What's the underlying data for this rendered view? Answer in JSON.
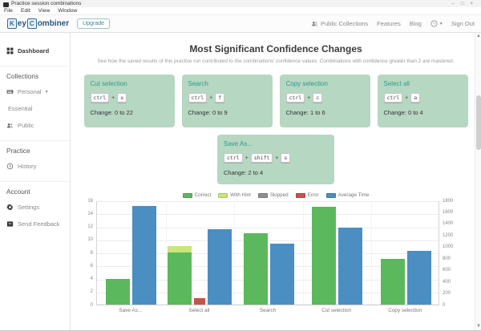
{
  "window": {
    "title": "Practice session combinations",
    "menu": [
      "File",
      "Edit",
      "View",
      "Window"
    ],
    "controls": {
      "minimize": "–",
      "maximize": "□",
      "close": "×"
    }
  },
  "header": {
    "logo": {
      "key_k": "K",
      "mid": "ey",
      "key_c": "C",
      "rest": "ombiner"
    },
    "upgrade_label": "Upgrade",
    "nav": {
      "public_collections": "Public Collections",
      "features": "Features",
      "blog": "Blog",
      "help": "?",
      "sign_out": "Sign Out"
    }
  },
  "sidebar": {
    "dashboard": "Dashboard",
    "sections": [
      {
        "header": "Collections",
        "items": [
          {
            "label": "Personal"
          },
          {
            "label": "Essential"
          },
          {
            "label": "Public"
          }
        ]
      },
      {
        "header": "Practice",
        "items": [
          {
            "label": "History"
          }
        ]
      },
      {
        "header": "Account",
        "items": [
          {
            "label": "Settings"
          },
          {
            "label": "Send Feedback"
          }
        ]
      }
    ]
  },
  "main": {
    "title": "Most Significant Confidence Changes",
    "subtitle": "See how the saved results of this practice run contributed to the combinations' confidence values. Combinations with confidence greater than 2 are mastered.",
    "cards": [
      {
        "title": "Cut selection",
        "keys": [
          "ctrl",
          "x"
        ],
        "plus": "+",
        "change": "Change: 0 to 22"
      },
      {
        "title": "Search",
        "keys": [
          "ctrl",
          "f"
        ],
        "plus": "+",
        "change": "Change: 0 to 9"
      },
      {
        "title": "Copy selection",
        "keys": [
          "ctrl",
          "c"
        ],
        "plus": "+",
        "change": "Change: 1 to 6"
      },
      {
        "title": "Select all",
        "keys": [
          "ctrl",
          "a"
        ],
        "plus": "+",
        "change": "Change: 0 to 4"
      }
    ],
    "save_card": {
      "title": "Save As...",
      "keys": [
        "ctrl",
        "shift",
        "s"
      ],
      "plus": "+",
      "change": "Change: 2 to 4"
    }
  },
  "chart_data": {
    "type": "bar",
    "categories": [
      "Save As...",
      "Select all",
      "Search",
      "Cut selection",
      "Copy selection"
    ],
    "series": [
      {
        "name": "Correct",
        "color": "#5cb85c",
        "axis": "left",
        "values": [
          4,
          8,
          11,
          15,
          7
        ]
      },
      {
        "name": "With Hint",
        "color": "#cbe47c",
        "axis": "left",
        "values": [
          0,
          1,
          0,
          0,
          0
        ],
        "stacked_on": "Correct"
      },
      {
        "name": "Skipped",
        "color": "#8e8e8e",
        "axis": "left",
        "values": [
          0,
          0,
          0,
          0,
          0
        ]
      },
      {
        "name": "Error",
        "color": "#c4534e",
        "axis": "left",
        "values": [
          0,
          1,
          0,
          0,
          0
        ]
      },
      {
        "name": "Average Time",
        "color": "#4a8ec2",
        "axis": "right",
        "values": [
          1700,
          1300,
          1050,
          1330,
          930
        ]
      }
    ],
    "left_axis": {
      "min": 0,
      "max": 16,
      "step": 2
    },
    "right_axis": {
      "min": 0,
      "max": 1800,
      "step": 200
    },
    "grid": true,
    "legend_position": "top"
  }
}
